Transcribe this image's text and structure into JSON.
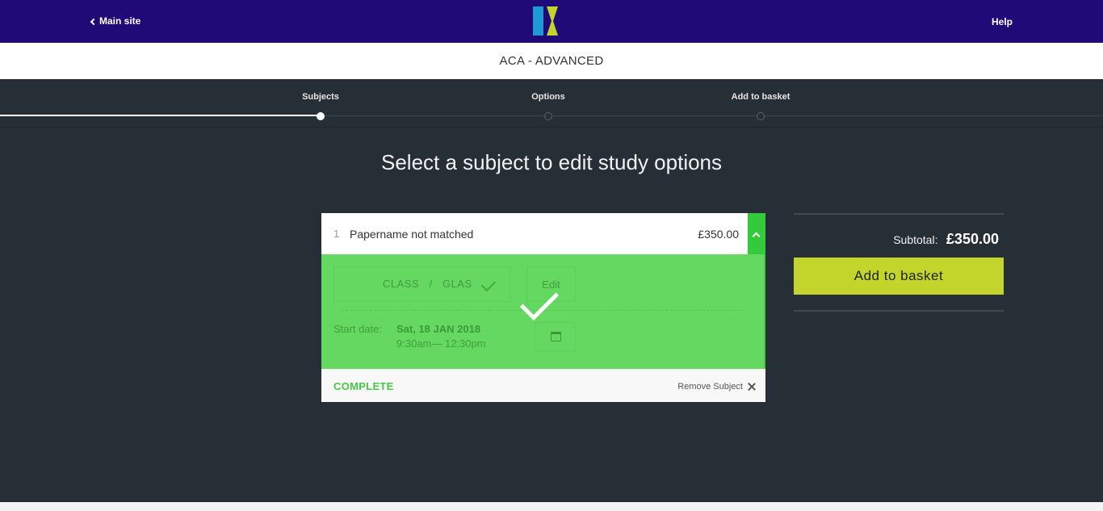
{
  "header": {
    "back_label": "Main site",
    "help_label": "Help",
    "logo_icon": "kaplan-k-logo",
    "colors": {
      "bar": "#1f0a78",
      "logo_blue": "#1e9ad6",
      "logo_green": "#c3d52b"
    }
  },
  "course_title": "ACA - ADVANCED",
  "steps": [
    {
      "label": "Subjects",
      "state": "active"
    },
    {
      "label": "Options",
      "state": "pending"
    },
    {
      "label": "Add to basket",
      "state": "pending"
    }
  ],
  "heading": "Select a subject to edit study options",
  "subject": {
    "number": "1",
    "name": "Papername not matched",
    "price": "£350.00",
    "course_type": "CLASS",
    "separator": "/",
    "location": "GLAS",
    "edit_label": "Edit",
    "start_label": "Start date:",
    "start_date": "Sat, 18 JAN 2018",
    "start_time": "9:30am— 12:30pm",
    "status": "COMPLETE",
    "remove_label": "Remove Subject",
    "colors": {
      "complete": "#64d861",
      "status_text": "#46c944"
    }
  },
  "summary": {
    "subtotal_label": "Subtotal:",
    "subtotal_value": "£350.00",
    "add_button": "Add to basket",
    "button_color": "#c3d52b"
  }
}
